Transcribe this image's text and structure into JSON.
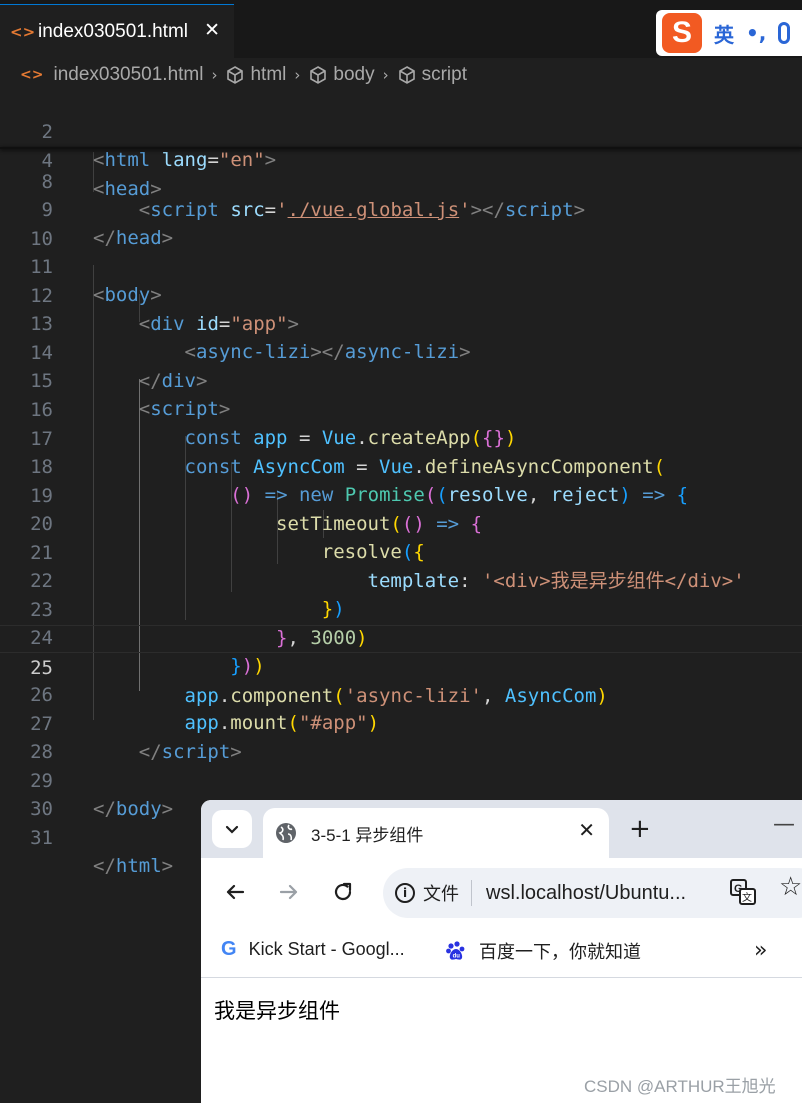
{
  "editor": {
    "tab_icon": "<>",
    "tab_label": "index030501.html",
    "tab_close": "✕",
    "breadcrumb": {
      "icon": "<>",
      "file": "index030501.html",
      "items": [
        "html",
        "body",
        "script"
      ]
    },
    "line_numbers": [
      "2",
      "4",
      "8",
      "9",
      "10",
      "11",
      "12",
      "13",
      "14",
      "15",
      "16",
      "17",
      "18",
      "19",
      "20",
      "21",
      "22",
      "23",
      "24",
      "25",
      "26",
      "27",
      "28",
      "29",
      "30",
      "31"
    ],
    "active_line": "25"
  },
  "ime": {
    "logo": "S",
    "lang": "英",
    "punct": "•,",
    "mic": "mic-icon"
  },
  "browser": {
    "tab_title": "3-5-1 异步组件",
    "tab_close": "✕",
    "new_tab": "+",
    "minimize": "—",
    "info_label": "文件",
    "url": "wsl.localhost/Ubuntu...",
    "bookmarks": [
      {
        "label": "Kick Start - Googl...",
        "icon": "google-icon"
      },
      {
        "label": "百度一下，你就知道",
        "icon": "baidu-icon"
      }
    ],
    "bookmarks_more": "»",
    "page_text": "我是异步组件"
  },
  "watermark": "CSDN @ARTHUR王旭光",
  "colors": {
    "editor_bg": "#1f1f1f",
    "tag": "#569cd6",
    "string": "#ce9178",
    "function": "#dcdcaa",
    "class": "#4ec9b0",
    "number": "#b5cea8",
    "ime_brand": "#f25a22"
  }
}
